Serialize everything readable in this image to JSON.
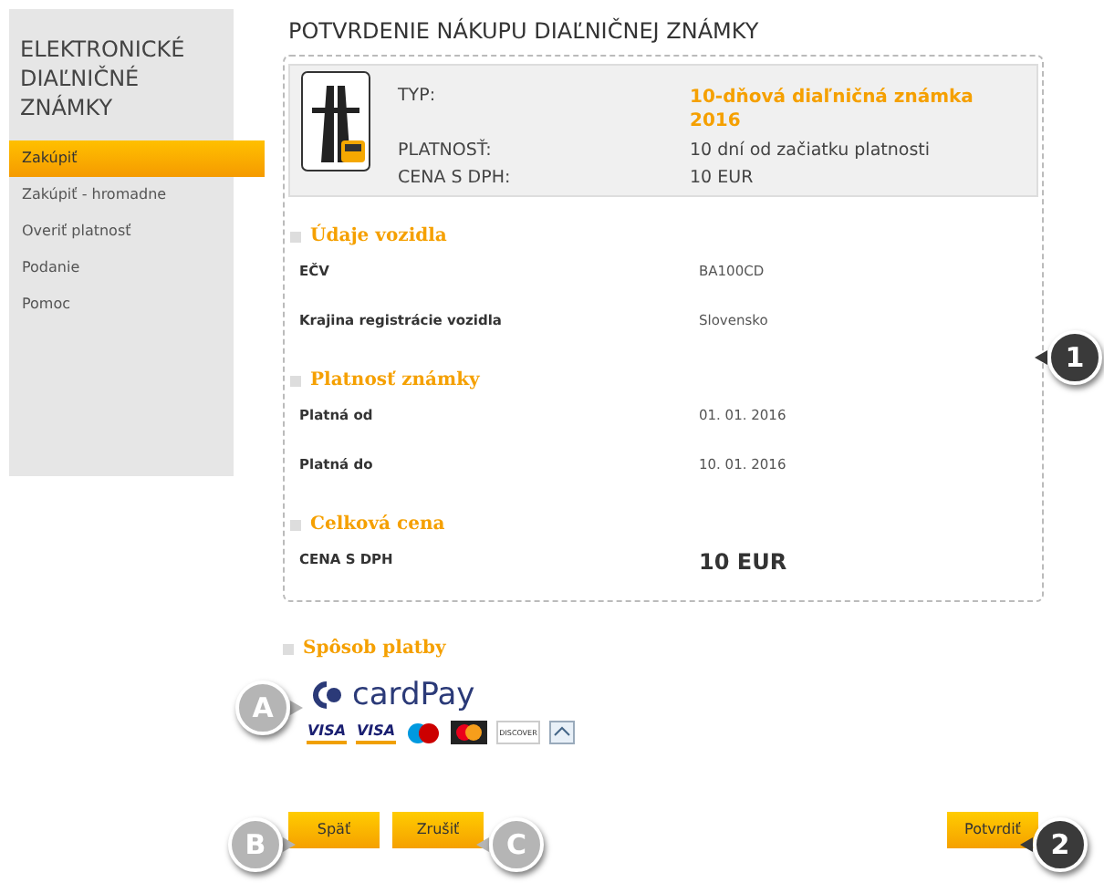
{
  "sidebar": {
    "title": "ELEKTRONICKÉ DIAĽNIČNÉ ZNÁMKY",
    "items": [
      {
        "label": "Zakúpiť",
        "selected": true
      },
      {
        "label": "Zakúpiť - hromadne",
        "selected": false
      },
      {
        "label": "Overiť platnosť",
        "selected": false
      },
      {
        "label": "Podanie",
        "selected": false
      },
      {
        "label": "Pomoc",
        "selected": false
      }
    ]
  },
  "page_title": "POTVRDENIE NÁKUPU DIAĽNIČNEJ ZNÁMKY",
  "summary": [
    {
      "label": "TYP:",
      "value": "10-dňová diaľničná známka 2016",
      "highlight": true
    },
    {
      "label": "PLATNOSŤ:",
      "value": "10 dní od začiatku platnosti",
      "highlight": false
    },
    {
      "label": "CENA S DPH:",
      "value": "10 EUR",
      "highlight": false
    }
  ],
  "sections": [
    {
      "heading": "Údaje vozidla",
      "rows": [
        {
          "label": "EČV",
          "value": "BA100CD",
          "big": false
        },
        {
          "label": "Krajina registrácie vozidla",
          "value": "Slovensko",
          "big": false
        }
      ]
    },
    {
      "heading": "Platnosť známky",
      "rows": [
        {
          "label": "Platná od",
          "value": "01. 01. 2016",
          "big": false
        },
        {
          "label": "Platná do",
          "value": "10. 01. 2016",
          "big": false
        }
      ]
    },
    {
      "heading": "Celková cena",
      "rows": [
        {
          "label": "CENA S DPH",
          "value": "10 EUR",
          "big": true
        }
      ]
    }
  ],
  "payment": {
    "heading": "Spôsob platby",
    "provider": "cardPay",
    "cards": [
      {
        "kind": "visa",
        "label": "VISA"
      },
      {
        "kind": "visa",
        "label": "VISA"
      },
      {
        "kind": "maestro"
      },
      {
        "kind": "mastercard"
      },
      {
        "kind": "discover",
        "label": "DISCOVER"
      },
      {
        "kind": "other"
      }
    ]
  },
  "buttons": {
    "back": "Späť",
    "cancel": "Zrušiť",
    "confirm": "Potvrdiť"
  },
  "callouts": [
    {
      "label": "1",
      "color": "#3a3a3a",
      "kind": "card"
    },
    {
      "label": "A",
      "color": "#b5b5b5",
      "kind": "payment"
    },
    {
      "label": "B",
      "color": "#b5b5b5",
      "kind": "back"
    },
    {
      "label": "C",
      "color": "#b5b5b5",
      "kind": "cancel"
    },
    {
      "label": "2",
      "color": "#3a3a3a",
      "kind": "confirm"
    }
  ]
}
